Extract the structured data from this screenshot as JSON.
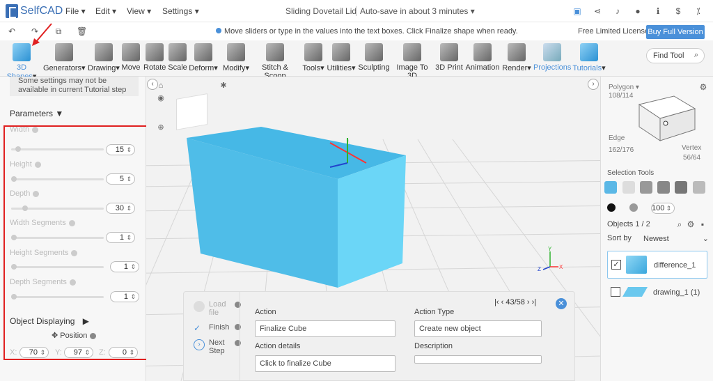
{
  "app": {
    "logo": "SelfCAD",
    "menus": [
      "File",
      "Edit",
      "View",
      "Settings"
    ],
    "doc_title": "Sliding Dovetail Lid",
    "autosave": "Auto-save in about 3 minutes"
  },
  "hint": {
    "text": "Move sliders or type in the values into the text boxes. Click Finalize shape when ready.",
    "license": "Free Limited License",
    "buy": "Buy Full Version"
  },
  "toolbar": {
    "tools": [
      {
        "label": "3D Shapes",
        "icon": "cube-icon"
      },
      {
        "label": "Generators",
        "icon": "generators-icon"
      },
      {
        "label": "Drawing",
        "icon": "drawing-icon"
      },
      {
        "label": "Move",
        "icon": "move-icon"
      },
      {
        "label": "Rotate",
        "icon": "rotate-icon"
      },
      {
        "label": "Scale",
        "icon": "scale-icon"
      },
      {
        "label": "Deform",
        "icon": "deform-icon"
      },
      {
        "label": "Modify",
        "icon": "modify-icon"
      },
      {
        "label": "Stitch & Scoop",
        "icon": "stitch-scoop-icon"
      },
      {
        "label": "Tools",
        "icon": "tools-icon"
      },
      {
        "label": "Utilities",
        "icon": "utilities-icon"
      },
      {
        "label": "Sculpting",
        "icon": "sculpting-icon"
      },
      {
        "label": "Image To 3D",
        "icon": "image-to-3d-icon"
      },
      {
        "label": "3D Print",
        "icon": "3d-print-icon"
      },
      {
        "label": "Animation",
        "icon": "animation-icon"
      },
      {
        "label": "Render",
        "icon": "render-icon"
      },
      {
        "label": "Projections",
        "icon": "projections-icon"
      },
      {
        "label": "Tutorials",
        "icon": "tutorials-icon"
      }
    ],
    "find": "Find Tool"
  },
  "left": {
    "notice": "Some settings may not be available in current Tutorial step",
    "title": "Parameters",
    "params": [
      {
        "label": "Width",
        "value": "15"
      },
      {
        "label": "Height",
        "value": "5"
      },
      {
        "label": "Depth",
        "value": "30"
      },
      {
        "label": "Width Segments",
        "value": "1"
      },
      {
        "label": "Height Segments",
        "value": "1"
      },
      {
        "label": "Depth Segments",
        "value": "1"
      }
    ],
    "object_displaying": "Object Displaying",
    "position": "Position",
    "x_label": "X:",
    "x": "70",
    "y_label": "Y:",
    "y": "97",
    "z_label": "Z:",
    "z": "0"
  },
  "action": {
    "steps": [
      "Load file",
      "Finish",
      "Next Step"
    ],
    "nav": "43/58",
    "action_label": "Action",
    "action_value": "Finalize Cube",
    "details_label": "Action details",
    "details_value": "Click to finalize Cube",
    "type_label": "Action Type",
    "type_value": "Create new object",
    "desc_label": "Description",
    "desc_value": ""
  },
  "right": {
    "polygon_label": "Polygon",
    "polygon_count": "108/114",
    "edge_label": "Edge",
    "edge_count": "162/176",
    "vertex_label": "Vertex",
    "vertex_count": "56/64",
    "selection_tools": "Selection Tools",
    "opacity": "100",
    "objects_label": "Objects 1 / 2",
    "sort_label": "Sort by",
    "sort_value": "Newest",
    "objects": [
      {
        "name": "difference_1",
        "checked": true
      },
      {
        "name": "drawing_1 (1)",
        "checked": false
      }
    ]
  },
  "colors": {
    "accent": "#4a90d9",
    "box_face": "#5bcbf0",
    "box_top": "#46b8e6",
    "selection_border": "#e02020"
  }
}
